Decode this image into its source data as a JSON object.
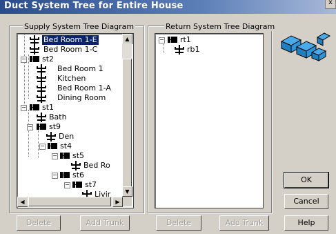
{
  "window": {
    "title": "Duct System Tree for Entire House",
    "close_label": "x"
  },
  "supply": {
    "title": "Supply System Tree Diagram",
    "delete_label": "Delete",
    "add_trunk_label": "Add Trunk",
    "rows": [
      {
        "label": "Bed Room 1-E",
        "type": "room",
        "selected": true
      },
      {
        "label": "Bed Room 1-C",
        "type": "room"
      },
      {
        "label": "st2",
        "type": "trunk"
      },
      {
        "label": "Bed Room 1",
        "type": "room"
      },
      {
        "label": "Kitchen",
        "type": "room"
      },
      {
        "label": "Bed Room 1-A",
        "type": "room"
      },
      {
        "label": "Dining Room",
        "type": "room"
      },
      {
        "label": "st1",
        "type": "trunk"
      },
      {
        "label": "Bath",
        "type": "room"
      },
      {
        "label": "st9",
        "type": "trunk"
      },
      {
        "label": "Den",
        "type": "room"
      },
      {
        "label": "st4",
        "type": "trunk"
      },
      {
        "label": "st5",
        "type": "trunk"
      },
      {
        "label": "Bed Ro",
        "type": "room"
      },
      {
        "label": "st6",
        "type": "trunk"
      },
      {
        "label": "st7",
        "type": "trunk"
      },
      {
        "label": "Livir",
        "type": "room"
      }
    ]
  },
  "return": {
    "title": "Return System Tree Diagram",
    "delete_label": "Delete",
    "add_trunk_label": "Add Trunk",
    "rows": [
      {
        "label": "rt1",
        "type": "trunk"
      },
      {
        "label": "rb1",
        "type": "room"
      }
    ]
  },
  "buttons": {
    "ok": "OK",
    "cancel": "Cancel",
    "help": "Help"
  }
}
